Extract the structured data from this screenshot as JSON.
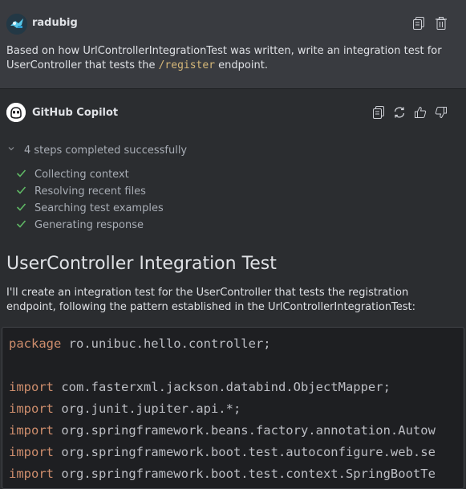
{
  "user_message": {
    "username": "radubig",
    "prompt_before": "Based on how UrlControllerIntegrationTest was written, write an integration test for UserController that tests the ",
    "prompt_code": "/register",
    "prompt_after": " endpoint."
  },
  "assistant": {
    "name": "GitHub Copilot",
    "steps_summary": "4 steps completed successfully",
    "steps": [
      {
        "label": "Collecting context"
      },
      {
        "label": "Resolving recent files"
      },
      {
        "label": "Searching test examples"
      },
      {
        "label": "Generating response"
      }
    ],
    "title": "UserController Integration Test",
    "description": "I'll create an integration test for the UserController that tests the registration endpoint, following the pattern established in the UrlControllerIntegrationTest:",
    "code_lines": [
      {
        "kw": "package",
        "rest": " ro.unibuc.hello.controller;"
      },
      {
        "kw": "",
        "rest": ""
      },
      {
        "kw": "import",
        "rest": " com.fasterxml.jackson.databind.ObjectMapper;"
      },
      {
        "kw": "import",
        "rest": " org.junit.jupiter.api.*;"
      },
      {
        "kw": "import",
        "rest": " org.springframework.beans.factory.annotation.Autow"
      },
      {
        "kw": "import",
        "rest": " org.springframework.boot.test.autoconfigure.web.se"
      },
      {
        "kw": "import",
        "rest": " org.springframework.boot.test.context.SpringBootTe"
      }
    ]
  },
  "colors": {
    "check": "#5fb865",
    "keyword": "#cf8e6d",
    "inline_code": "#d5b778"
  }
}
